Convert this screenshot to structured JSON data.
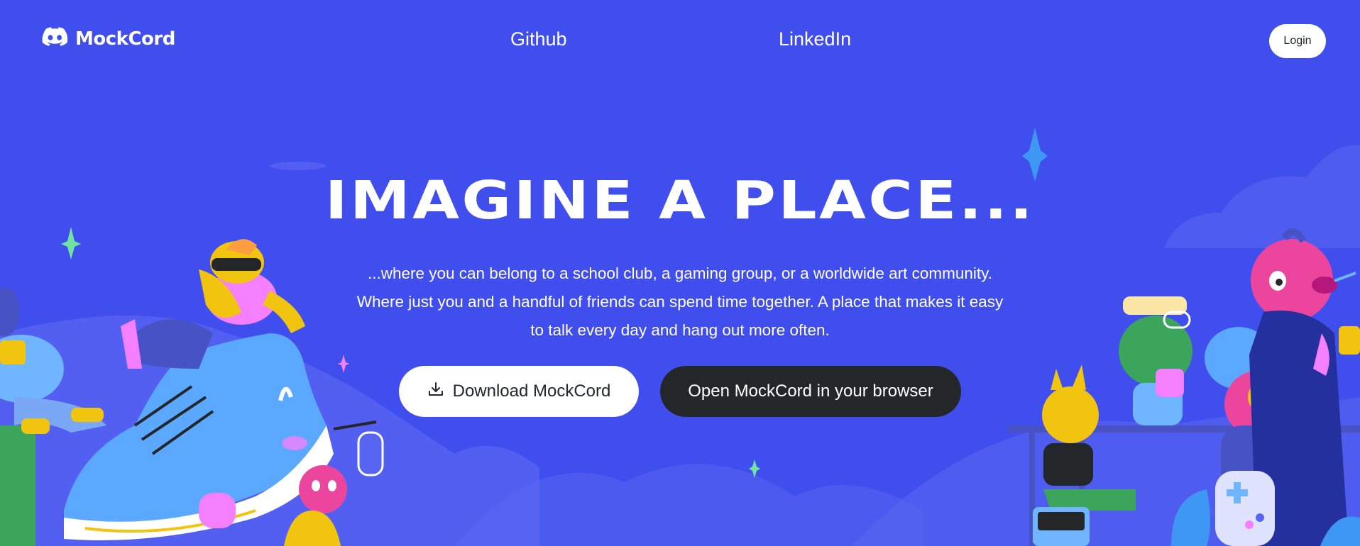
{
  "brand": {
    "name": "MockCord",
    "logo_icon": "discord-controller-icon"
  },
  "nav": {
    "links": [
      {
        "label": "Github"
      },
      {
        "label": "LinkedIn"
      }
    ],
    "login_label": "Login"
  },
  "hero": {
    "title": "IMAGINE A PLACE...",
    "lines": [
      "...where you can belong to a school club, a gaming group, or a worldwide art community.",
      "Where just you and a handful of friends can spend time together. A place that makes it easy",
      "to talk every day and hang out more often."
    ],
    "download_label": "Download MockCord",
    "download_icon": "download-icon",
    "browser_label": "Open MockCord in your browser"
  },
  "colors": {
    "background": "#404eed",
    "button_dark": "#23272a",
    "button_light": "#ffffff"
  }
}
